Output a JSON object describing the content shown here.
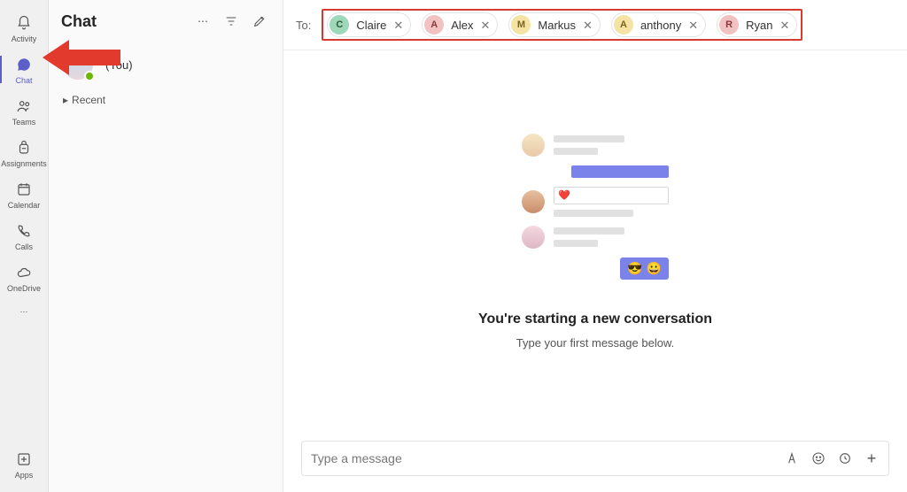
{
  "rail": {
    "items": [
      {
        "label": "Activity",
        "icon": "bell"
      },
      {
        "label": "Chat",
        "icon": "chat",
        "active": true
      },
      {
        "label": "Teams",
        "icon": "people"
      },
      {
        "label": "Assignments",
        "icon": "backpack"
      },
      {
        "label": "Calendar",
        "icon": "calendar"
      },
      {
        "label": "Calls",
        "icon": "phone"
      },
      {
        "label": "OneDrive",
        "icon": "cloud"
      }
    ],
    "apps_label": "Apps"
  },
  "chatlist": {
    "title": "Chat",
    "draft_label": "(You)",
    "recent_label": "Recent"
  },
  "to": {
    "label": "To:",
    "recipients": [
      {
        "initial": "C",
        "name": "Claire",
        "bg": "#9fd8b8",
        "fg": "#2a5c3e"
      },
      {
        "initial": "A",
        "name": "Alex",
        "bg": "#f2c2c2",
        "fg": "#8a3a3a"
      },
      {
        "initial": "M",
        "name": "Markus",
        "bg": "#f4e3a3",
        "fg": "#7a6521"
      },
      {
        "initial": "A",
        "name": "anthony",
        "bg": "#f4e3a3",
        "fg": "#7a6521"
      },
      {
        "initial": "R",
        "name": "Ryan",
        "bg": "#f2c2c2",
        "fg": "#8a3a3a"
      }
    ]
  },
  "empty": {
    "title": "You're starting a new conversation",
    "subtitle": "Type your first message below.",
    "emoji": "😎 😀"
  },
  "compose": {
    "placeholder": "Type a message"
  }
}
